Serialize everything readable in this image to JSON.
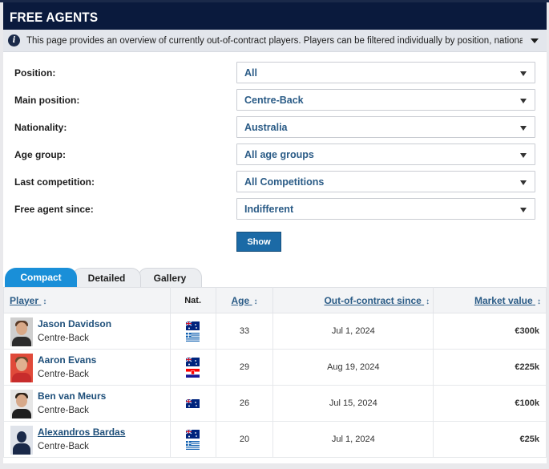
{
  "header": {
    "title": "FREE AGENTS"
  },
  "info": {
    "text": "This page provides an overview of currently out-of-contract players. Players can be filtered individually by position, nationality, their last com..."
  },
  "filters": [
    {
      "label": "Position:",
      "value": "All"
    },
    {
      "label": "Main position:",
      "value": "Centre-Back"
    },
    {
      "label": "Nationality:",
      "value": "Australia"
    },
    {
      "label": "Age group:",
      "value": "All age groups"
    },
    {
      "label": "Last competition:",
      "value": "All Competitions"
    },
    {
      "label": "Free agent since:",
      "value": "Indifferent"
    }
  ],
  "show_button": "Show",
  "tabs": [
    "Compact",
    "Detailed",
    "Gallery"
  ],
  "table": {
    "columns": {
      "player": "Player",
      "nat": "Nat.",
      "age": "Age",
      "since": "Out-of-contract since",
      "value": "Market value",
      "sort_icon": "↕"
    },
    "rows": [
      {
        "name": "Jason Davidson",
        "position": "Centre-Back",
        "flags": [
          "australia-flag",
          "greece-flag"
        ],
        "age": "33",
        "since": "Jul 1, 2024",
        "value": "€300k"
      },
      {
        "name": "Aaron Evans",
        "position": "Centre-Back",
        "flags": [
          "australia-flag",
          "croatia-flag"
        ],
        "age": "29",
        "since": "Aug 19, 2024",
        "value": "€225k"
      },
      {
        "name": "Ben van Meurs",
        "position": "Centre-Back",
        "flags": [
          "australia-flag"
        ],
        "age": "26",
        "since": "Jul 15, 2024",
        "value": "€100k"
      },
      {
        "name": "Alexandros Bardas",
        "position": "Centre-Back",
        "flags": [
          "australia-flag",
          "greece-flag"
        ],
        "age": "20",
        "since": "Jul 1, 2024",
        "value": "€25k"
      }
    ]
  },
  "colors": {
    "header_bg": "#0a1a3d",
    "link": "#1e4f7a",
    "active_tab": "#1a8fd8",
    "button": "#1b6aa6"
  }
}
